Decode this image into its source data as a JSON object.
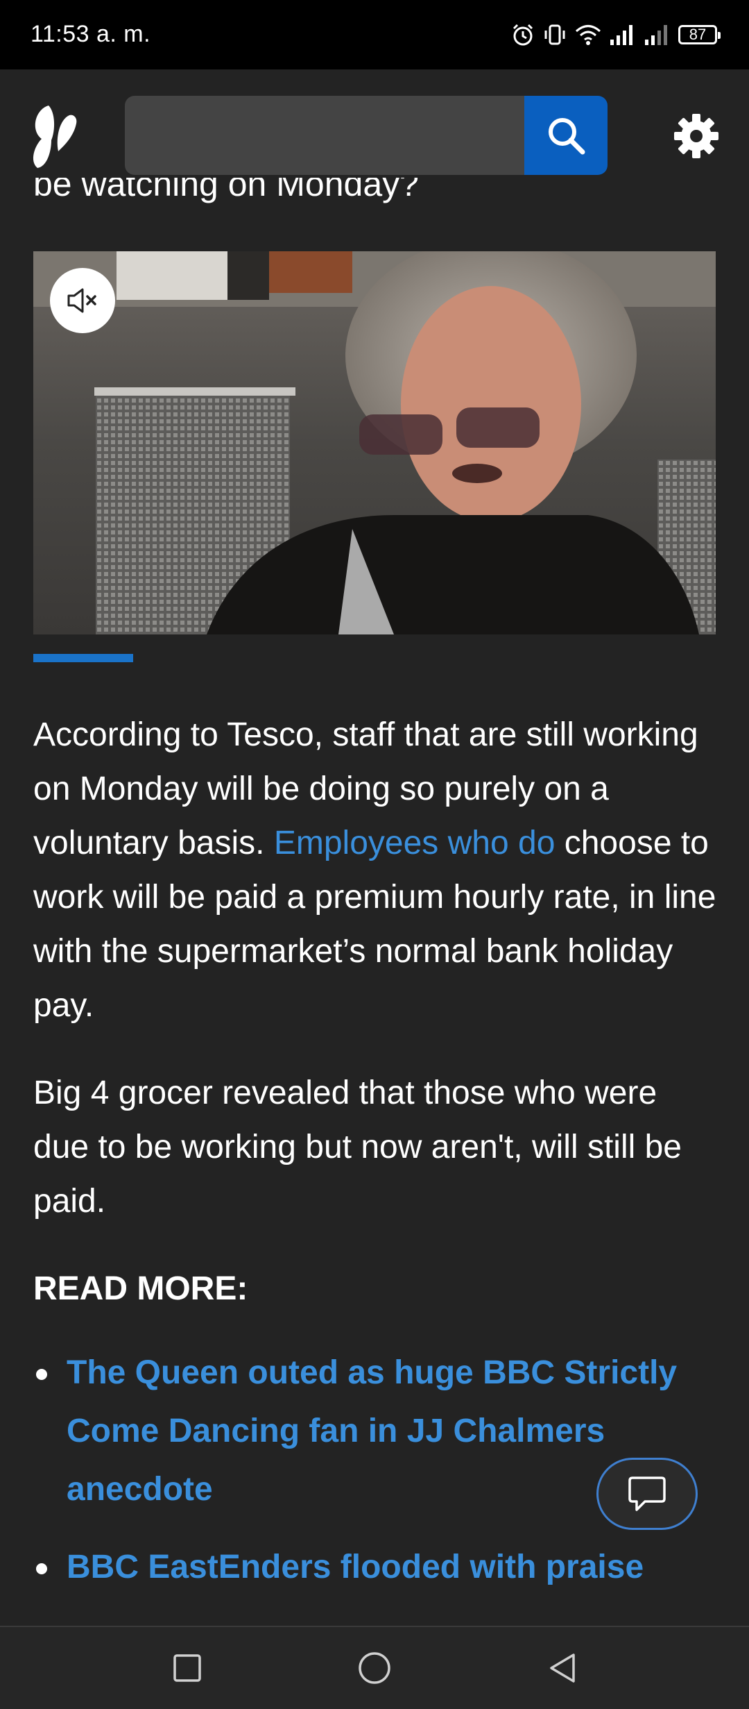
{
  "status_bar": {
    "time": "11:53 a. m.",
    "battery": "87",
    "icons": [
      "alarm-icon",
      "vibrate-icon",
      "wifi-icon",
      "signal-icon",
      "signal-icon",
      "battery-icon"
    ]
  },
  "header": {
    "logo": "butterfly-logo",
    "search": {
      "placeholder": "",
      "value": ""
    },
    "search_icon": "search-icon",
    "settings_icon": "gear-icon",
    "accent_color": "#0a5fbf"
  },
  "article": {
    "clipped_heading": "be watching on Monday?",
    "video": {
      "muted": true,
      "mute_icon": "muted-speaker-icon"
    },
    "paragraph1": {
      "part1": "According to Tesco, staff that are still working on Monday will be doing so purely on a voluntary basis. ",
      "link": "Employees who do",
      "part2": " choose to work will be paid a premium hourly rate, in line with the supermarket’s normal bank holiday pay."
    },
    "paragraph2": "Big 4 grocer revealed that those who were due to be working but now aren't, will still be paid.",
    "read_more_heading": "READ MORE:",
    "read_more_links": [
      "The Queen outed as huge BBC Strictly Come Dancing fan in JJ Chalmers anecdote",
      "BBC EastEnders flooded with praise"
    ],
    "link_color": "#3a8fdc"
  },
  "comment_button": {
    "icon": "chat-bubble-icon"
  },
  "nav_bar": {
    "buttons": [
      "recents-square-icon",
      "home-circle-icon",
      "back-triangle-icon"
    ]
  }
}
